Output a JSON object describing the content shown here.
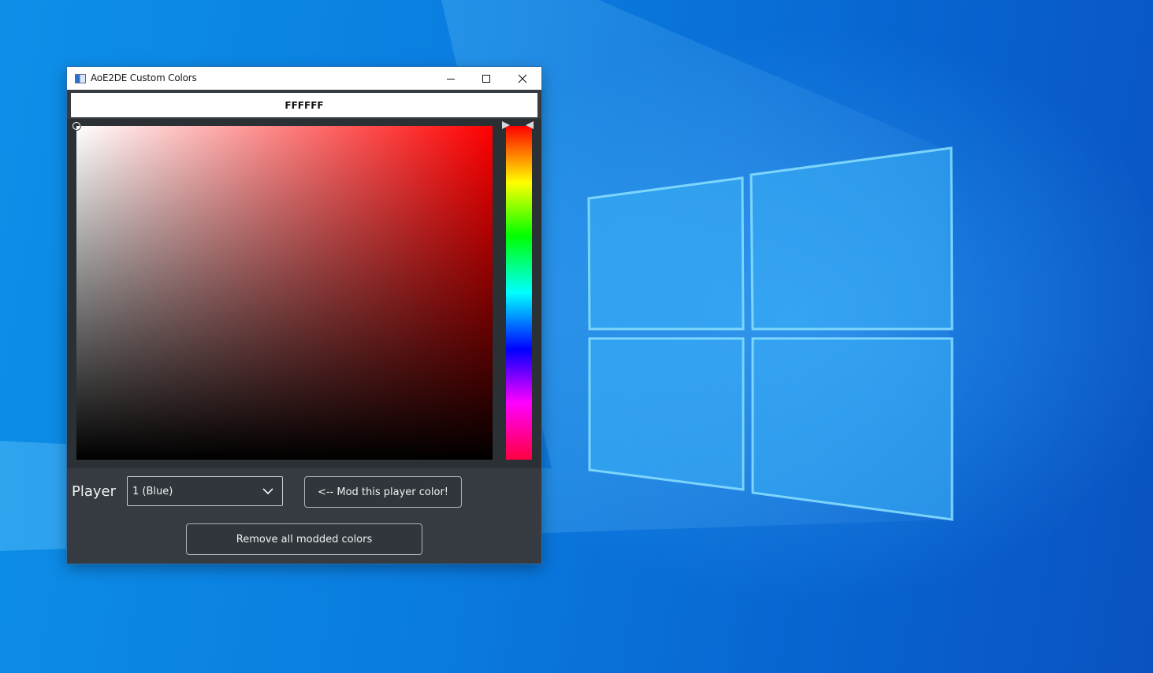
{
  "window": {
    "title": "AoE2DE Custom Colors",
    "app_icon": "app-window-icon"
  },
  "titlebar_controls": {
    "minimize_icon": "minimize-icon",
    "maximize_icon": "maximize-icon",
    "close_icon": "close-icon"
  },
  "color": {
    "hex": "FFFFFF",
    "selected_hue": "#ff0000"
  },
  "player": {
    "label": "Player",
    "selected": "1 (Blue)"
  },
  "buttons": {
    "mod_label": "<-- Mod this player color!",
    "remove_label": "Remove all modded colors"
  },
  "colors": {
    "desktop": "#0a7de0",
    "window_body": "#353b40",
    "picker_background": "#2b3035"
  }
}
